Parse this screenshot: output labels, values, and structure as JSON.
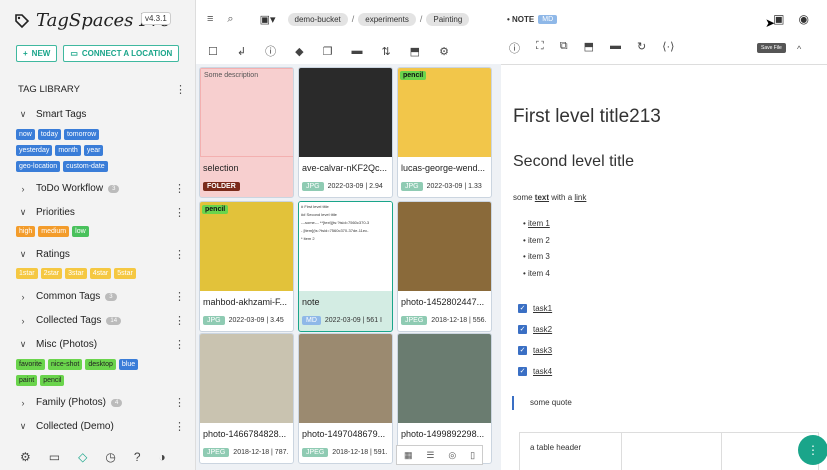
{
  "app": {
    "name": "TagSpaces Pro",
    "version": "v4.3.1"
  },
  "left": {
    "new_label": "NEW",
    "connect_label": "CONNECT A LOCATION",
    "tag_library": "TAG LIBRARY",
    "smart_tags": "Smart Tags",
    "smart_tag_items": [
      [
        "now",
        "today",
        "tomorrow"
      ],
      [
        "yesterday",
        "month",
        "year"
      ],
      [
        "geo-location",
        "custom-date"
      ]
    ],
    "todo": "ToDo Workflow",
    "todo_count": "3",
    "priorities": "Priorities",
    "priority_tags": [
      "high",
      "medium",
      "low"
    ],
    "ratings": "Ratings",
    "rating_tags": [
      "1star",
      "2star",
      "3star",
      "4star",
      "5star"
    ],
    "common": "Common Tags",
    "common_count": "3",
    "collected": "Collected Tags",
    "collected_count": "14",
    "misc": "Misc (Photos)",
    "misc_tags": [
      "favorite",
      "nice-shot",
      "desktop",
      "blue",
      "paint",
      "pencil"
    ],
    "family": "Family (Photos)",
    "family_count": "4",
    "collected_demo": "Collected (Demo)"
  },
  "breadcrumb": [
    "demo-bucket",
    "experiments",
    "Painting"
  ],
  "grid": [
    {
      "title": "selection",
      "desc": "Some description",
      "ext": "FOLDER",
      "meta": "",
      "color": "#f7cfcf"
    },
    {
      "title": "ave-calvar-nKF2Qc...",
      "ext": "JPG",
      "meta": "2022-03-09 | 2.94",
      "color": "#2a2a2a"
    },
    {
      "title": "lucas-george-wend...",
      "ext": "JPG",
      "meta": "2022-03-09 | 1.33",
      "color": "#f2c64a",
      "tag": "pencil"
    },
    {
      "title": "mahbod-akhzami-F...",
      "ext": "JPG",
      "meta": "2022-03-09 | 3.45",
      "color": "#e2c23a",
      "tag": "pencil"
    },
    {
      "title": "note",
      "ext": "MD",
      "meta": "2022-03-09 | 561 I",
      "color": "#ffffff"
    },
    {
      "title": "photo-1452802447...",
      "ext": "JPEG",
      "meta": "2018-12-18 | 556.",
      "color": "#8a6a3a"
    },
    {
      "title": "photo-1466784828...",
      "ext": "JPEG",
      "meta": "2018-12-18 | 787.",
      "color": "#c9c3b0"
    },
    {
      "title": "photo-1497048679...",
      "ext": "JPEG",
      "meta": "2018-12-18 | 591.",
      "color": "#9b8a70"
    },
    {
      "title": "photo-1499892298...",
      "ext": "JPEG",
      "meta": "",
      "color": "#6a7c70"
    }
  ],
  "note_md_preview": [
    "# First level title",
    "## Second level title",
    "---some--- **[text](ts:?tsid=7560c370-3",
    "- [item](ts:?tsid=7560c370-37de-11ec-",
    "* item 2"
  ],
  "right": {
    "label": "NOTE",
    "ext": "MD",
    "save_tip": "Save File",
    "h1": "First level title213",
    "h2": "Second level title",
    "para": [
      "some ",
      "text",
      " with a ",
      "link"
    ],
    "items": [
      "item 1",
      "item 2",
      "item 3",
      "item 4"
    ],
    "tasks": [
      "task1",
      "task2",
      "task3",
      "task4"
    ],
    "quote": "some quote",
    "table_header": "a table header"
  }
}
